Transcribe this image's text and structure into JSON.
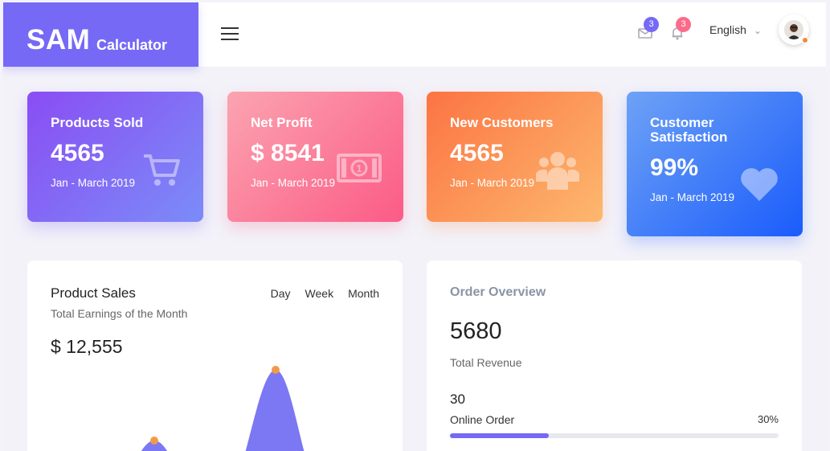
{
  "brand": {
    "name": "SAM",
    "sub": "Calculator"
  },
  "header": {
    "mail_count": "3",
    "notif_count": "3",
    "language": "English",
    "colors": {
      "mail_badge": "#7569f5",
      "notif_badge": "#fb6c8a"
    }
  },
  "stats": [
    {
      "title": "Products Sold",
      "value": "4565",
      "period": "Jan - March 2019",
      "icon": "cart-icon"
    },
    {
      "title": "Net Profit",
      "value": "$ 8541",
      "period": "Jan - March 2019",
      "icon": "cash-icon"
    },
    {
      "title": "New Customers",
      "value": "4565",
      "period": "Jan - March 2019",
      "icon": "users-icon"
    },
    {
      "title": "Customer Satisfaction",
      "value": "99%",
      "period": "Jan - March 2019",
      "icon": "heart-icon"
    }
  ],
  "product_sales": {
    "title": "Product Sales",
    "subtitle": "Total Earnings of the Month",
    "amount": "$ 12,555",
    "tabs": [
      "Day",
      "Week",
      "Month"
    ]
  },
  "order_overview": {
    "title": "Order Overview",
    "revenue": "5680",
    "revenue_label": "Total Revenue",
    "online_count": "30",
    "online_label": "Online Order",
    "online_pct": "30%",
    "online_fraction": 0.3
  }
}
